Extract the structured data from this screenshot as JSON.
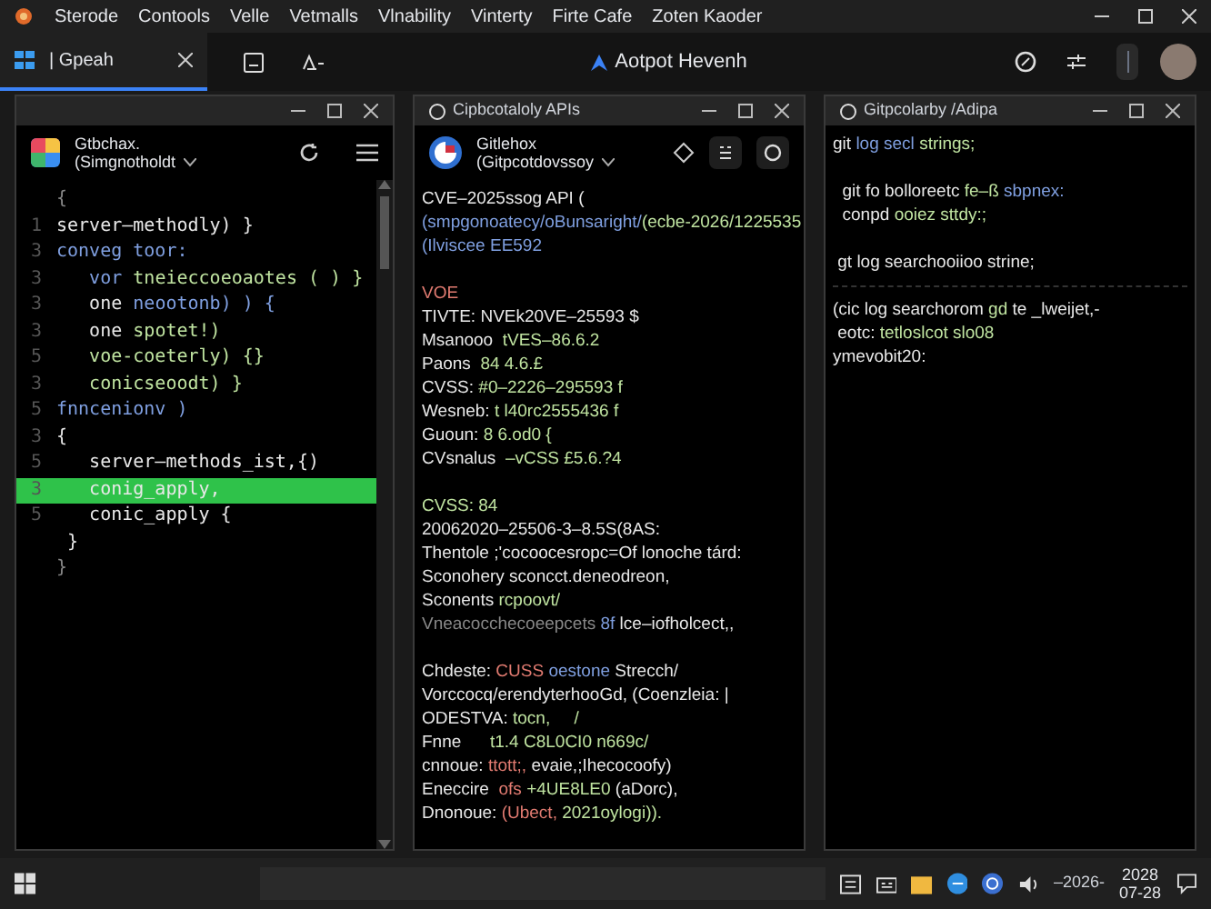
{
  "menu_bar": {
    "items": [
      "Sterode",
      "Contools",
      "Velle",
      "Vetmalls",
      "Vlnability",
      "Vinterty",
      "Firte Cafe",
      "Zoten Kaoder"
    ]
  },
  "tab_bar": {
    "tabs": [
      {
        "label": "| Gpeah",
        "selected": true
      }
    ],
    "title": "Aotpot Hevenh"
  },
  "panes": [
    {
      "header": {
        "name": "Gtbchax.",
        "subtitle": "(Simgnotholdt"
      },
      "scrollbar": true,
      "lines": [
        {
          "segments": [
            {
              "text": "{",
              "kind": "dim"
            }
          ],
          "highlighted": false
        },
        {
          "number": "1",
          "segments": [
            {
              "text": "server–methodly) }",
              "kind": "plain"
            }
          ],
          "highlighted": false
        },
        {
          "number": "3",
          "segments": [
            {
              "text": "conveg toor:",
              "kind": "keyword"
            }
          ],
          "highlighted": false
        },
        {
          "number": "3",
          "segments": [
            {
              "text": "   vor ",
              "kind": "keyword"
            },
            {
              "text": "tneieccoeoaotes ( ) }",
              "kind": "string"
            }
          ],
          "highlighted": false
        },
        {
          "number": "3",
          "segments": [
            {
              "text": "   one ",
              "kind": "plain"
            },
            {
              "text": "neootonb) ) {",
              "kind": "keyword"
            }
          ],
          "highlighted": false
        },
        {
          "number": "3",
          "segments": [
            {
              "text": "   one ",
              "kind": "plain"
            },
            {
              "text": "spotet!)",
              "kind": "string"
            }
          ],
          "highlighted": false
        },
        {
          "number": "5",
          "segments": [
            {
              "text": "   voe-coeterly) {}",
              "kind": "string"
            }
          ],
          "highlighted": false
        },
        {
          "number": "3",
          "segments": [
            {
              "text": "   conicseoodt) }",
              "kind": "string"
            }
          ],
          "highlighted": false
        },
        {
          "number": "5",
          "segments": [
            {
              "text": "fnncenionv )",
              "kind": "keyword"
            }
          ],
          "highlighted": false
        },
        {
          "number": "3",
          "segments": [
            {
              "text": "{",
              "kind": "plain"
            }
          ],
          "highlighted": false
        },
        {
          "number": "5",
          "segments": [
            {
              "text": "   server–methods_ist,{)",
              "kind": "plain"
            }
          ],
          "highlighted": false
        },
        {
          "number": "3",
          "segments": [
            {
              "text": "   conig_apply,",
              "kind": "plain"
            }
          ],
          "highlighted": true
        },
        {
          "number": "5",
          "segments": [
            {
              "text": "   conic_apply {",
              "kind": "plain"
            }
          ],
          "highlighted": false
        },
        {
          "segments": [
            {
              "text": " }",
              "kind": "plain"
            }
          ],
          "highlighted": false
        },
        {
          "segments": [
            {
              "text": "}",
              "kind": "dim"
            }
          ],
          "highlighted": false
        }
      ]
    },
    {
      "title": "Cipbcotaloly APIs",
      "header": {
        "name": "Gitlehox",
        "subtitle": "(Gitpcotdovssoy"
      },
      "lines": [
        {
          "segments": [
            {
              "text": "CVE–2025ssog API (",
              "kind": "plain"
            }
          ]
        },
        {
          "segments": [
            {
              "text": "(smpgonoatecy/oBunsaright/",
              "kind": "keyword"
            },
            {
              "text": "(ecbe-2026/1225535",
              "kind": "string"
            }
          ]
        },
        {
          "segments": [
            {
              "text": "(Ilviscee EE592",
              "kind": "keyword"
            }
          ]
        },
        {
          "spaced": true,
          "segments": [
            {
              "text": "VOE",
              "kind": "warning"
            }
          ]
        },
        {
          "segments": [
            {
              "text": "TIVTE: ",
              "kind": "plain"
            },
            {
              "text": "NVEk20VE–25593 $",
              "kind": "plain"
            }
          ]
        },
        {
          "segments": [
            {
              "text": "Msanooo  ",
              "kind": "plain"
            },
            {
              "text": "tVES–86.6.2",
              "kind": "string"
            }
          ]
        },
        {
          "segments": [
            {
              "text": "Paons  ",
              "kind": "plain"
            },
            {
              "text": "84 4.6.£",
              "kind": "string"
            }
          ]
        },
        {
          "segments": [
            {
              "text": "CVSS: ",
              "kind": "plain"
            },
            {
              "text": "#0–2226–295593 f",
              "kind": "string"
            }
          ]
        },
        {
          "segments": [
            {
              "text": "Wesneb: ",
              "kind": "plain"
            },
            {
              "text": "t l40rc2555436 f",
              "kind": "string"
            }
          ]
        },
        {
          "segments": [
            {
              "text": "Guoun: ",
              "kind": "plain"
            },
            {
              "text": "8 6.od0 {",
              "kind": "string"
            }
          ]
        },
        {
          "segments": [
            {
              "text": "CVsnalus  ",
              "kind": "plain"
            },
            {
              "text": "–vCSS £5.6.?4",
              "kind": "string"
            }
          ]
        },
        {
          "spaced": true,
          "segments": [
            {
              "text": "CVSS: 84",
              "kind": "string"
            }
          ]
        },
        {
          "segments": [
            {
              "text": "20062020–25506-3–8.5S(8AS:",
              "kind": "plain"
            }
          ]
        },
        {
          "segments": [
            {
              "text": "Thentole ;'cocoocesropc=Of lonoche tárd:",
              "kind": "plain"
            }
          ]
        },
        {
          "segments": [
            {
              "text": "Sconohery sconcct.deneodreon,",
              "kind": "plain"
            }
          ]
        },
        {
          "segments": [
            {
              "text": "Sconents ",
              "kind": "plain"
            },
            {
              "text": "rcpoovt/",
              "kind": "string"
            }
          ]
        },
        {
          "segments": [
            {
              "text": "Vneacocchecoeepcets ",
              "kind": "dim"
            },
            {
              "text": "8f ",
              "kind": "keyword"
            },
            {
              "text": "lce–iofholcect,,",
              "kind": "plain"
            }
          ]
        },
        {
          "spaced": true,
          "segments": [
            {
              "text": "Chdeste: ",
              "kind": "plain"
            },
            {
              "text": "CUSS ",
              "kind": "warning"
            },
            {
              "text": "oestone ",
              "kind": "keyword"
            },
            {
              "text": "Strecch/",
              "kind": "plain"
            }
          ]
        },
        {
          "segments": [
            {
              "text": "Vorccocq/erendyterhooGd, (Coenzleia: |",
              "kind": "plain"
            }
          ]
        },
        {
          "segments": [
            {
              "text": "ODESTVA: ",
              "kind": "plain"
            },
            {
              "text": "tocn,     /",
              "kind": "string"
            }
          ]
        },
        {
          "segments": [
            {
              "text": "Fnne      ",
              "kind": "plain"
            },
            {
              "text": "t1.4 C8L0CI0 n669c/",
              "kind": "string"
            }
          ]
        },
        {
          "segments": [
            {
              "text": "cnnoue: ",
              "kind": "plain"
            },
            {
              "text": "ttott;, ",
              "kind": "warning"
            },
            {
              "text": "evaie,;Ihecocoofy)",
              "kind": "plain"
            }
          ]
        },
        {
          "segments": [
            {
              "text": "Eneccire  ",
              "kind": "plain"
            },
            {
              "text": "ofs ",
              "kind": "warning"
            },
            {
              "text": "+4UE8LE0 ",
              "kind": "string"
            },
            {
              "text": "(aDorc),",
              "kind": "plain"
            }
          ]
        },
        {
          "segments": [
            {
              "text": "Dnonoue: ",
              "kind": "plain"
            },
            {
              "text": "(Ubect, ",
              "kind": "warning"
            },
            {
              "text": "2021oylogi)).",
              "kind": "string"
            }
          ]
        }
      ]
    },
    {
      "title": "Gitpcolarby /Adipa",
      "lines": [
        {
          "segments": [
            {
              "text": "git ",
              "kind": "plain"
            },
            {
              "text": "log ",
              "kind": "keyword"
            },
            {
              "text": "secl ",
              "kind": "keyword"
            },
            {
              "text": "strings;",
              "kind": "string"
            }
          ]
        },
        {
          "spaced": true,
          "segments": [
            {
              "text": "  git fo bolloreetc ",
              "kind": "plain"
            },
            {
              "text": "fe–ß ",
              "kind": "string"
            },
            {
              "text": "sbpnex:",
              "kind": "keyword"
            }
          ]
        },
        {
          "segments": [
            {
              "text": "  conpd ",
              "kind": "plain"
            },
            {
              "text": "ooiez sttdy:;",
              "kind": "string"
            }
          ]
        },
        {
          "spaced": true,
          "segments": [
            {
              "text": " gt log searchooiioo strine;",
              "kind": "plain"
            }
          ]
        },
        {
          "divider": true,
          "segments": [
            {
              "text": "(cic log searchorom ",
              "kind": "plain"
            },
            {
              "text": "gd ",
              "kind": "string"
            },
            {
              "text": "te _lweijet,-",
              "kind": "plain"
            }
          ]
        },
        {
          "segments": [
            {
              "text": " eotc: ",
              "kind": "plain"
            },
            {
              "text": "tetloslcot slo08",
              "kind": "string"
            }
          ]
        },
        {
          "segments": [
            {
              "text": "ymevobit20:",
              "kind": "plain"
            }
          ]
        }
      ]
    }
  ],
  "taskbar": {
    "tray_text": "–2026-",
    "clock": {
      "time": "2028",
      "date": "07-28"
    }
  }
}
